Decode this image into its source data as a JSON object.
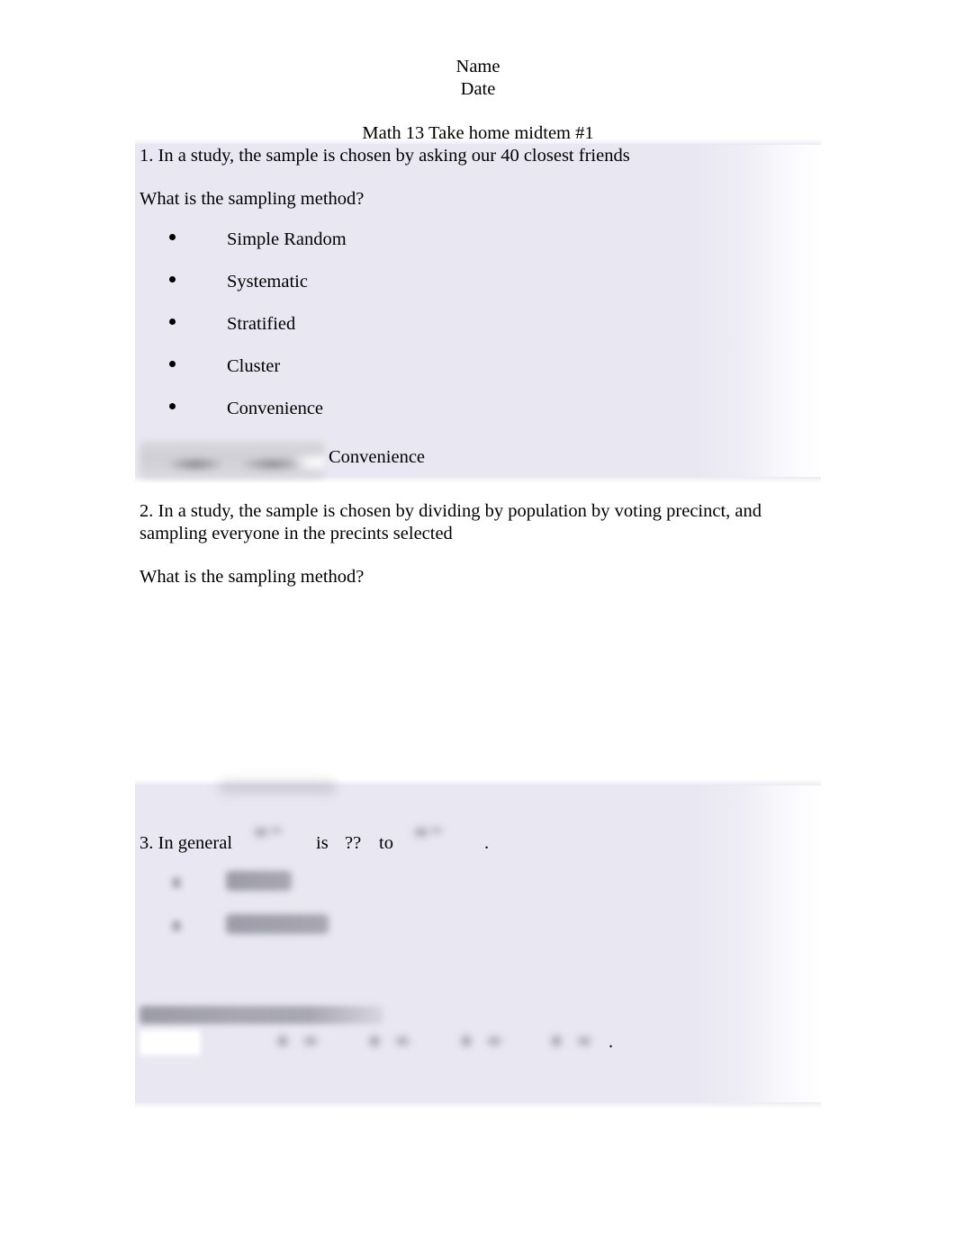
{
  "document": {
    "header": {
      "name_label": "Name",
      "date_label": "Date"
    },
    "title": "Math 13 Take home midtem #1"
  },
  "questions": [
    {
      "number": "1",
      "stem": "1. In a study, the sample is chosen by asking our 40 closest friends",
      "prompt": "What is the sampling method?",
      "options": [
        "Simple Random",
        "Systematic",
        "Stratified",
        "Cluster",
        "Convenience"
      ],
      "answer": "Convenience",
      "redacted_widget_label": ""
    },
    {
      "number": "2",
      "stem": "2. In a study, the sample is chosen by dividing by population by voting precinct, and sampling everyone in the precints selected",
      "prompt": "What is the sampling method?",
      "answer": ""
    },
    {
      "number": "3",
      "lead": "3. In general",
      "is_word": "is",
      "unknown": "??",
      "to_word": "to",
      "end_period": ".",
      "symbol_a": "",
      "symbol_b": "",
      "options": [
        "",
        ""
      ],
      "subhead": "",
      "values": [
        "",
        "",
        "",
        ""
      ],
      "values_period": "."
    }
  ],
  "style": {
    "highlight_color": "#e9e7f1",
    "page_background": "#ffffff",
    "text_color": "#000000"
  }
}
